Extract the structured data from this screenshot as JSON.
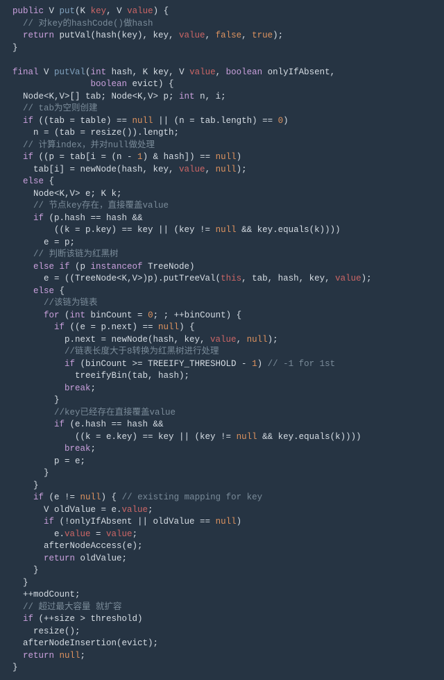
{
  "code": {
    "l01a": "public",
    "l01b": " V ",
    "l01c": "put",
    "l01d": "(K ",
    "l01e": "key",
    "l01f": ", V ",
    "l01g": "value",
    "l01h": ") {",
    "l02": "  // 对key的hashCode()做hash",
    "l03a": "  return",
    "l03b": " putVal(hash(key), key, ",
    "l03c": "value",
    "l03d": ", ",
    "l03e": "false",
    "l03f": ", ",
    "l03g": "true",
    "l03h": ");",
    "l04": "}",
    "l05": "",
    "l06a": "final",
    "l06b": " V ",
    "l06c": "putVal",
    "l06d": "(",
    "l06e": "int",
    "l06f": " hash, K key, V ",
    "l06g": "value",
    "l06h": ", ",
    "l06i": "boolean",
    "l06j": " onlyIfAbsent,",
    "l07a": "               ",
    "l07b": "boolean",
    "l07c": " evict) {",
    "l08a": "  Node<K,V>[] tab; Node<K,V> p; ",
    "l08b": "int",
    "l08c": " n, i;",
    "l09": "  // tab为空则创建",
    "l10a": "  if",
    "l10b": " ((tab = table) == ",
    "l10c": "null",
    "l10d": " || (n = tab.length) == ",
    "l10e": "0",
    "l10f": ")",
    "l11": "    n = (tab = resize()).length;",
    "l12": "  // 计算index，并对null做处理",
    "l13a": "  if",
    "l13b": " ((p = tab[i = (n - ",
    "l13c": "1",
    "l13d": ") & hash]) == ",
    "l13e": "null",
    "l13f": ")",
    "l14a": "    tab[i] = newNode(hash, key, ",
    "l14b": "value",
    "l14c": ", ",
    "l14d": "null",
    "l14e": ");",
    "l15a": "  else",
    "l15b": " {",
    "l16": "    Node<K,V> e; K k;",
    "l17": "    // 节点key存在，直接覆盖value",
    "l18a": "    if",
    "l18b": " (p.hash == hash &&",
    "l19a": "        ((k = p.key) == key || (key != ",
    "l19b": "null",
    "l19c": " && key.equals(k))))",
    "l20": "      e = p;",
    "l21": "    // 判断该链为红黑树",
    "l22a": "    else if",
    "l22b": " (p ",
    "l22c": "instanceof",
    "l22d": " TreeNode)",
    "l23a": "      e = ((TreeNode<K,V>)p).putTreeVal(",
    "l23b": "this",
    "l23c": ", tab, hash, key, ",
    "l23d": "value",
    "l23e": ");",
    "l24a": "    else",
    "l24b": " {",
    "l25": "      //该链为链表",
    "l26a": "      for",
    "l26b": " (",
    "l26c": "int",
    "l26d": " binCount = ",
    "l26e": "0",
    "l26f": "; ; ++binCount) {",
    "l27a": "        if",
    "l27b": " ((e = p.next) == ",
    "l27c": "null",
    "l27d": ") {",
    "l28a": "          p.next = newNode(hash, key, ",
    "l28b": "value",
    "l28c": ", ",
    "l28d": "null",
    "l28e": ");",
    "l29": "          //链表长度大于8转换为红黑树进行处理",
    "l30a": "          if",
    "l30b": " (binCount >= TREEIFY_THRESHOLD - ",
    "l30c": "1",
    "l30d": ") ",
    "l30e": "// -1 for 1st",
    "l31": "            treeifyBin(tab, hash);",
    "l32a": "          break",
    "l32b": ";",
    "l33": "        }",
    "l34": "        //key已经存在直接覆盖value",
    "l35a": "        if",
    "l35b": " (e.hash == hash &&",
    "l36a": "            ((k = e.key) == key || (key != ",
    "l36b": "null",
    "l36c": " && key.equals(k))))",
    "l37a": "          break",
    "l37b": ";",
    "l38": "        p = e;",
    "l39": "      }",
    "l40": "    }",
    "l41a": "    if",
    "l41b": " (e != ",
    "l41c": "null",
    "l41d": ") { ",
    "l41e": "// existing mapping for key",
    "l42a": "      V oldValue = e.",
    "l42b": "value",
    "l42c": ";",
    "l43a": "      if",
    "l43b": " (!onlyIfAbsent || oldValue == ",
    "l43c": "null",
    "l43d": ")",
    "l44a": "        e.",
    "l44b": "value",
    "l44c": " = ",
    "l44d": "value",
    "l44e": ";",
    "l45": "      afterNodeAccess(e);",
    "l46a": "      return",
    "l46b": " oldValue;",
    "l47": "    }",
    "l48": "  }",
    "l49": "  ++modCount;",
    "l50": "  // 超过最大容量 就扩容",
    "l51a": "  if",
    "l51b": " (++size > threshold)",
    "l52": "    resize();",
    "l53": "  afterNodeInsertion(evict);",
    "l54a": "  return ",
    "l54b": "null",
    "l54c": ";",
    "l55": "}"
  }
}
